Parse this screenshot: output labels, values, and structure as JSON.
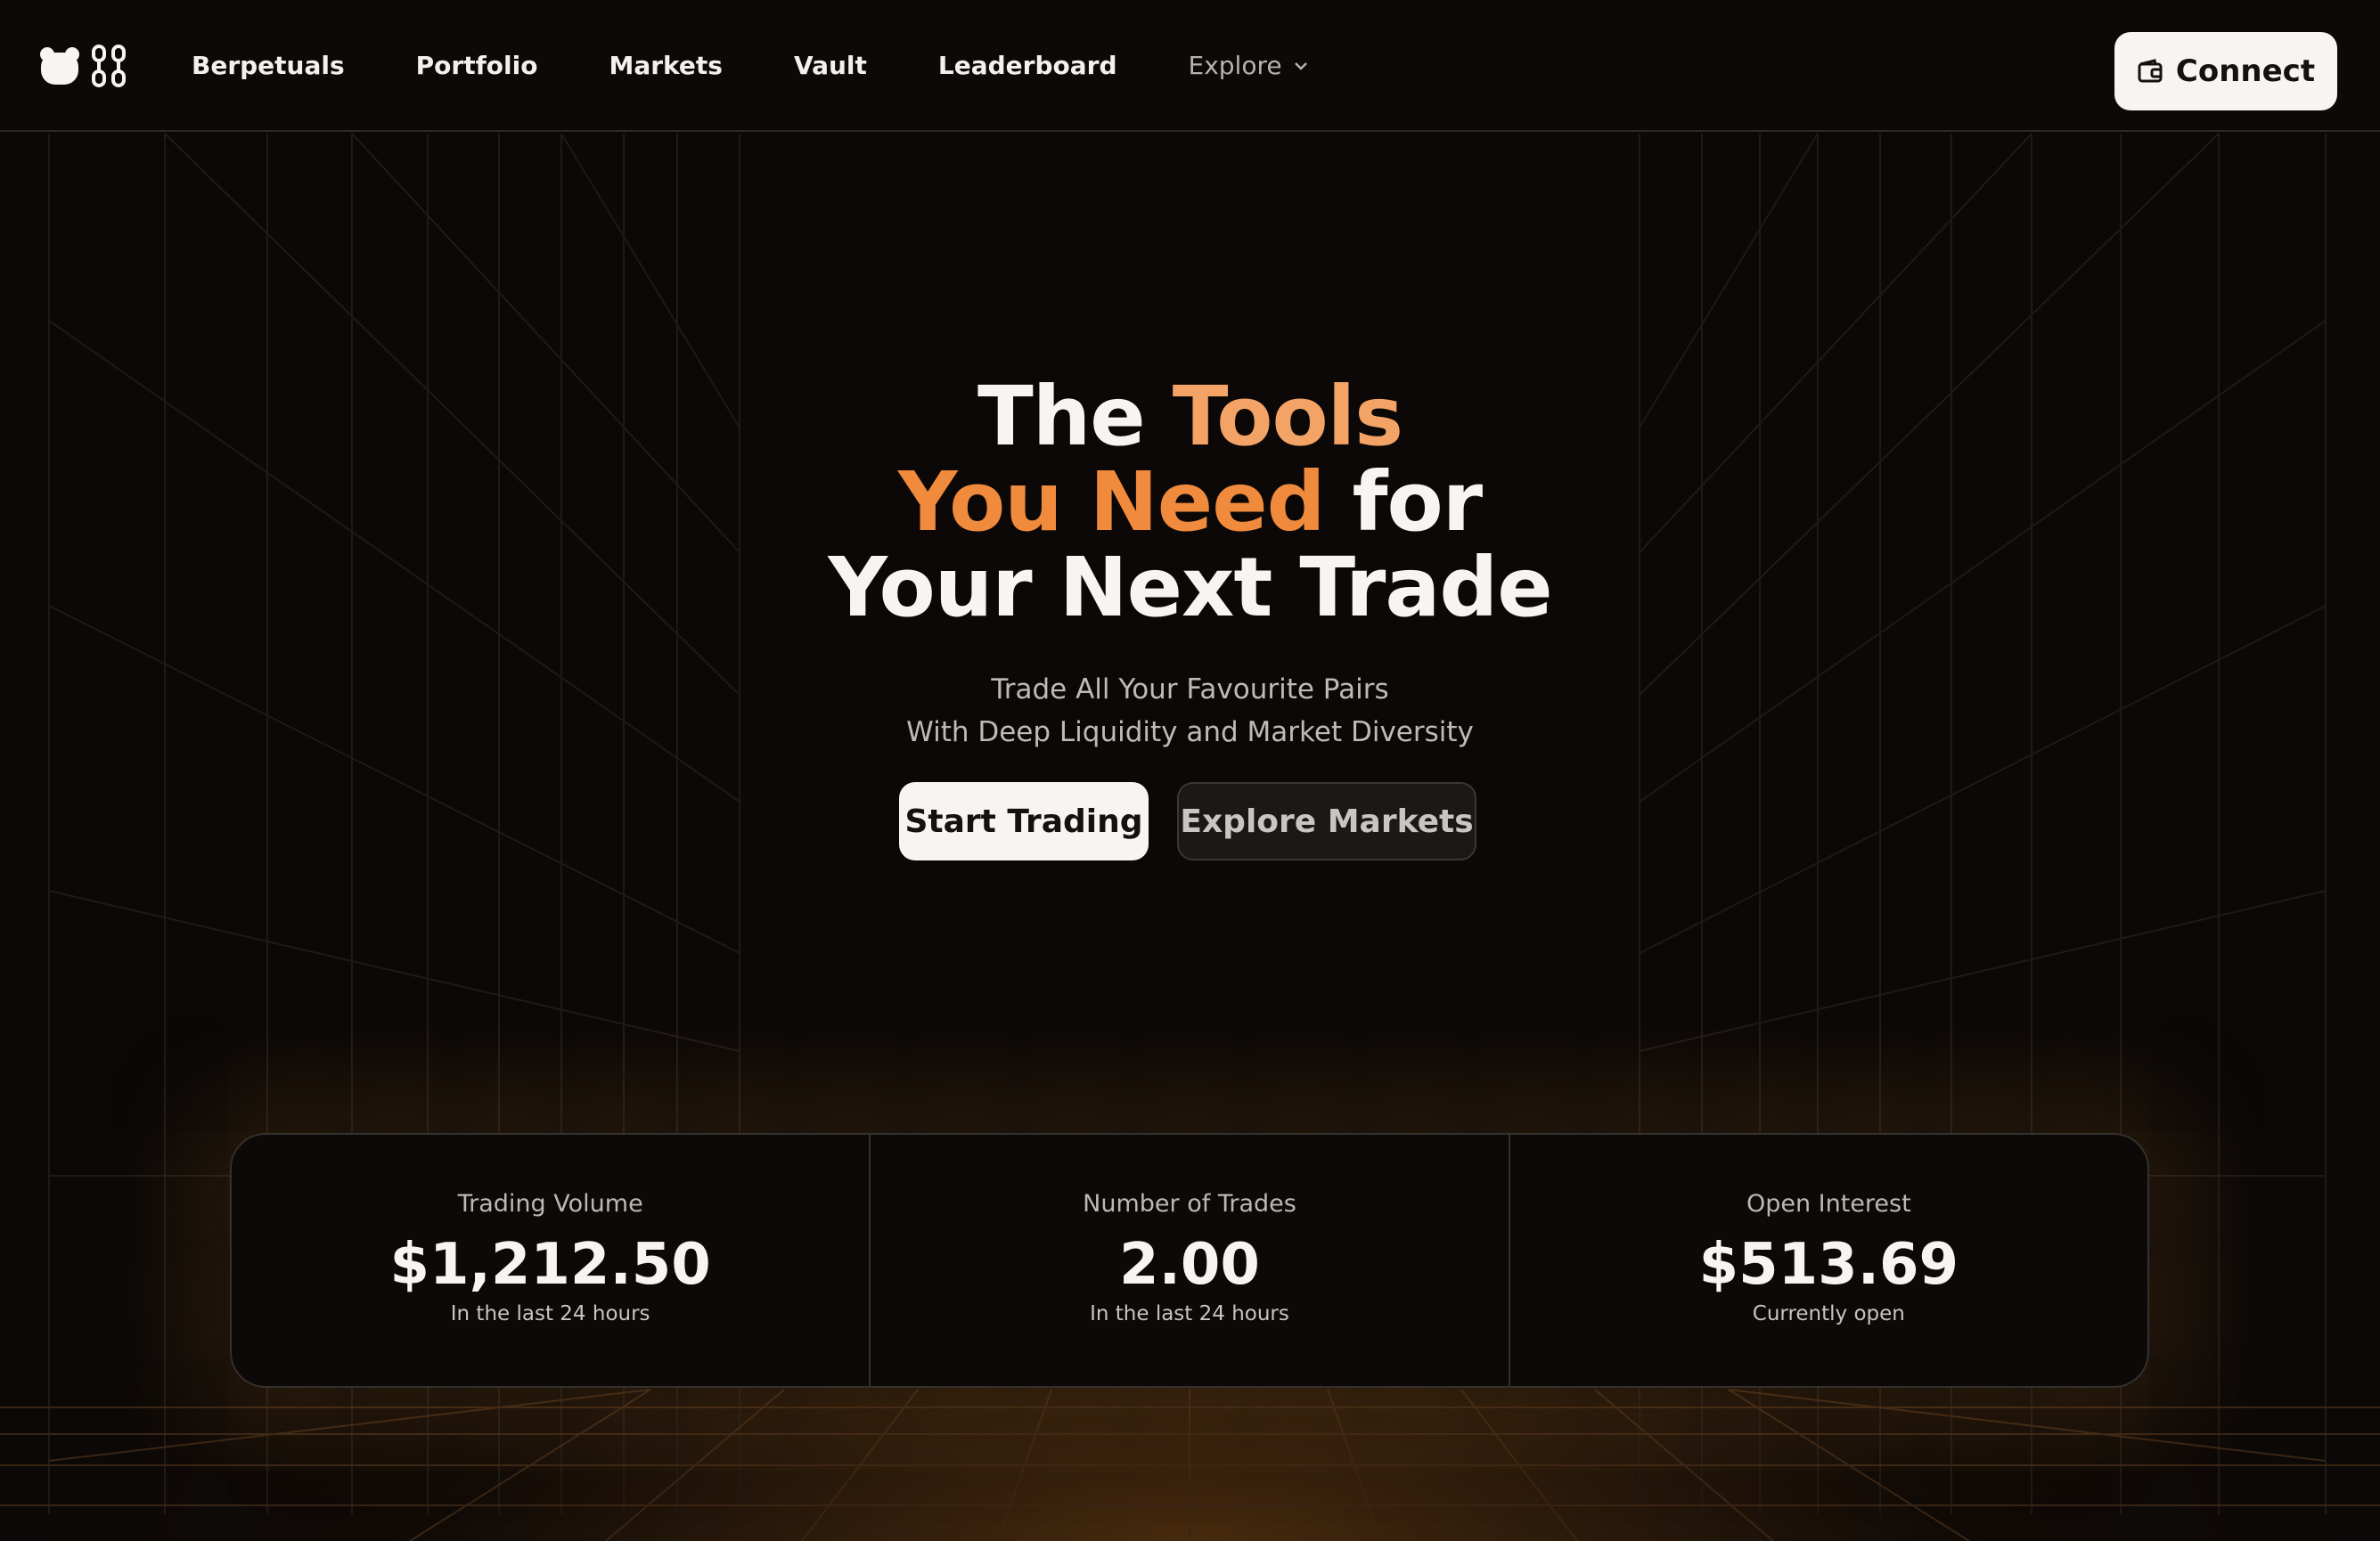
{
  "nav": {
    "links": [
      "Berpetuals",
      "Portfolio",
      "Markets",
      "Vault",
      "Leaderboard"
    ],
    "explore_label": "Explore",
    "connect_label": "Connect"
  },
  "hero": {
    "title_the": "The",
    "title_tools": "Tools",
    "title_you_need": "You Need",
    "title_for": "for",
    "title_line3": "Your Next Trade",
    "subtitle_line1": "Trade All Your Favourite Pairs",
    "subtitle_line2": "With Deep Liquidity and Market Diversity",
    "primary_cta": "Start Trading",
    "secondary_cta": "Explore Markets"
  },
  "stats": [
    {
      "label": "Trading Volume",
      "value": "$1,212.50",
      "caption": "In the last 24 hours"
    },
    {
      "label": "Number of Trades",
      "value": "2.00",
      "caption": "In the last 24 hours"
    },
    {
      "label": "Open Interest",
      "value": "$513.69",
      "caption": "Currently open"
    }
  ],
  "colors": {
    "background": "#0b0807",
    "accent": "#f08a3c",
    "accent_light": "#f2a365",
    "text": "#f7f5f2",
    "button_light": "#f7f5f2"
  },
  "icons": {
    "logo": "bear-logo-icon",
    "logo_mark": "chain-link-icon",
    "explore_chevron": "chevron-down-icon",
    "connect": "wallet-icon"
  }
}
